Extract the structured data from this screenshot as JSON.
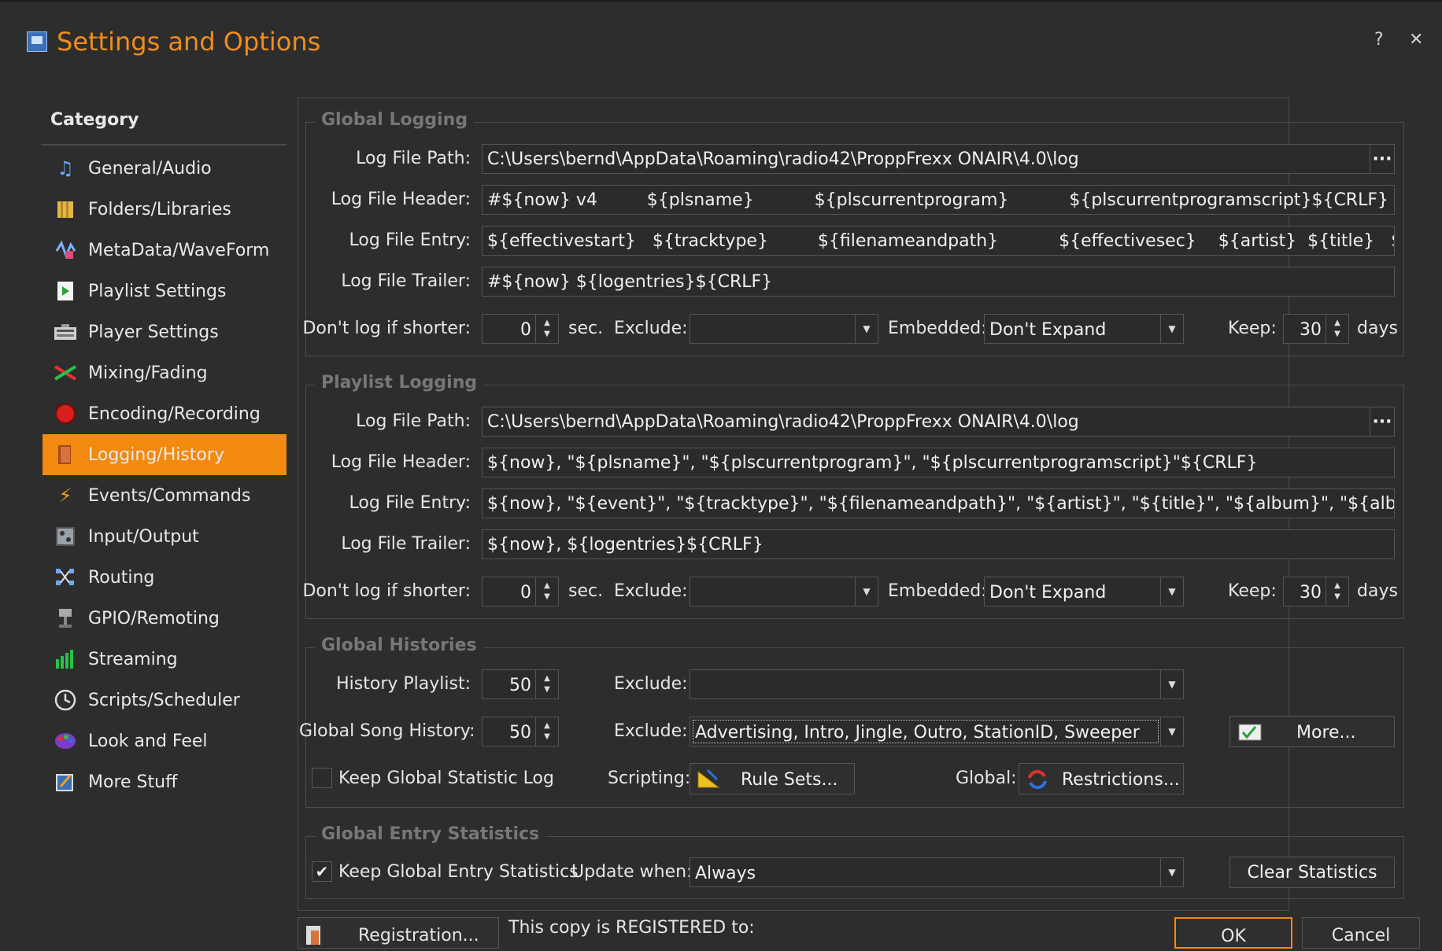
{
  "window": {
    "title": "Settings and Options",
    "help_label": "?",
    "close_label": "✕"
  },
  "sidebar": {
    "title": "Category",
    "items": [
      {
        "label": "General/Audio",
        "icon": "music-note-icon"
      },
      {
        "label": "Folders/Libraries",
        "icon": "folders-icon"
      },
      {
        "label": "MetaData/WaveForm",
        "icon": "metadata-icon"
      },
      {
        "label": "Playlist Settings",
        "icon": "playlist-icon"
      },
      {
        "label": "Player Settings",
        "icon": "player-icon"
      },
      {
        "label": "Mixing/Fading",
        "icon": "mixing-icon"
      },
      {
        "label": "Encoding/Recording",
        "icon": "record-icon"
      },
      {
        "label": "Logging/History",
        "icon": "logging-icon",
        "active": true
      },
      {
        "label": "Events/Commands",
        "icon": "lightning-icon"
      },
      {
        "label": "Input/Output",
        "icon": "input-output-icon"
      },
      {
        "label": "Routing",
        "icon": "routing-icon"
      },
      {
        "label": "GPIO/Remoting",
        "icon": "gpio-icon"
      },
      {
        "label": "Streaming",
        "icon": "streaming-icon"
      },
      {
        "label": "Scripts/Scheduler",
        "icon": "clock-icon"
      },
      {
        "label": "Look and Feel",
        "icon": "palette-icon"
      },
      {
        "label": "More Stuff",
        "icon": "more-stuff-icon"
      }
    ]
  },
  "global_logging": {
    "legend": "Global Logging",
    "path_label": "Log File Path:",
    "path_value": "C:\\Users\\bernd\\AppData\\Roaming\\radio42\\ProppFrexx ONAIR\\4.0\\log",
    "browse_label": "···",
    "header_label": "Log File Header:",
    "header_value": "#${now} v4         ${plsname}           ${plscurrentprogram}           ${plscurrentprogramscript}${CRLF}",
    "entry_label": "Log File Entry:",
    "entry_value": "${effectivestart}   ${tracktype}         ${filenameandpath}           ${effectivesec}    ${artist}  ${title}   ${album}",
    "trailer_label": "Log File Trailer:",
    "trailer_value": "#${now} ${logentries}${CRLF}",
    "shorter_label": "Don't log if shorter:",
    "shorter_value": "0",
    "sec_label": "sec.",
    "exclude_label": "Exclude:",
    "exclude_value": "",
    "embedded_label": "Embedded:",
    "embedded_value": "Don't Expand",
    "keep_label": "Keep:",
    "keep_value": "30",
    "days_label": "days"
  },
  "playlist_logging": {
    "legend": "Playlist Logging",
    "path_label": "Log File Path:",
    "path_value": "C:\\Users\\bernd\\AppData\\Roaming\\radio42\\ProppFrexx ONAIR\\4.0\\log",
    "browse_label": "···",
    "header_label": "Log File Header:",
    "header_value": "${now}, \"${plsname}\", \"${plscurrentprogram}\", \"${plscurrentprogramscript}\"${CRLF}",
    "entry_label": "Log File Entry:",
    "entry_value": "${now}, \"${event}\", \"${tracktype}\", \"${filenameandpath}\", \"${artist}\", \"${title}\", \"${album}\", \"${albumartist}\", \"${year",
    "trailer_label": "Log File Trailer:",
    "trailer_value": "${now}, ${logentries}${CRLF}",
    "shorter_label": "Don't log if shorter:",
    "shorter_value": "0",
    "sec_label": "sec.",
    "exclude_label": "Exclude:",
    "exclude_value": "",
    "embedded_label": "Embedded:",
    "embedded_value": "Don't Expand",
    "keep_label": "Keep:",
    "keep_value": "30",
    "days_label": "days"
  },
  "global_histories": {
    "legend": "Global Histories",
    "history_playlist_label": "History Playlist:",
    "history_playlist_value": "50",
    "exclude1_label": "Exclude:",
    "exclude1_value": "",
    "song_history_label": "Global Song History:",
    "song_history_value": "50",
    "exclude2_label": "Exclude:",
    "exclude2_value": "Advertising, Intro, Jingle, Outro, StationID, Sweeper",
    "more_label": "More...",
    "keep_stat_log_label": "Keep Global Statistic Log",
    "keep_stat_log_checked": false,
    "scripting_label": "Scripting:",
    "rule_sets_label": "Rule Sets...",
    "global_label": "Global:",
    "restrictions_label": "Restrictions..."
  },
  "global_entry_statistics": {
    "legend": "Global Entry Statistics",
    "keep_label": "Keep Global Entry Statistics",
    "keep_checked": true,
    "checkmark": "✔",
    "update_label": "Update when:",
    "update_value": "Always",
    "clear_label": "Clear Statistics"
  },
  "footer": {
    "registration_label": "Registration...",
    "registered_text": "This copy is REGISTERED to:",
    "ok_label": "OK",
    "cancel_label": "Cancel"
  },
  "colors": {
    "accent": "#f28a10",
    "title": "#f08d1a",
    "background": "#2d2d2d"
  }
}
